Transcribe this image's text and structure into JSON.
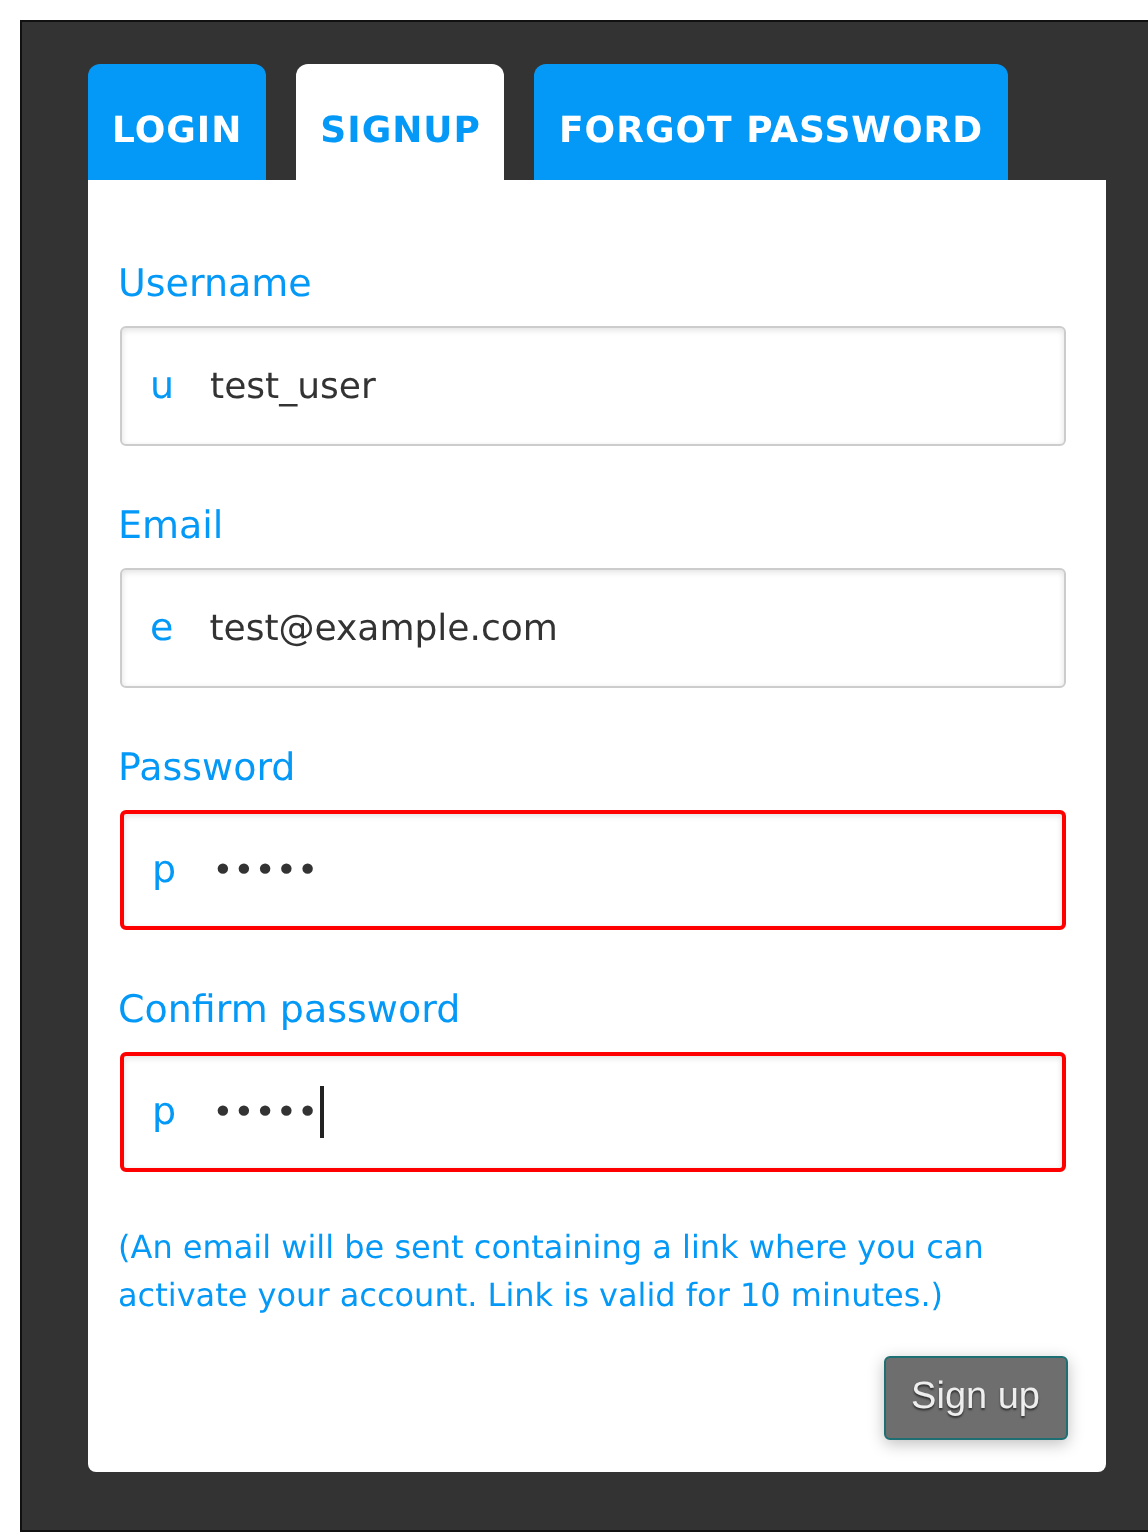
{
  "tabs": [
    {
      "label": "LOGIN",
      "selected": false
    },
    {
      "label": "SIGNUP",
      "selected": true
    },
    {
      "label": "FORGOT PASSWORD",
      "selected": false
    }
  ],
  "fields": [
    {
      "label": "Username",
      "prefix": "u",
      "value": "test_user",
      "invalid": false,
      "focused": false
    },
    {
      "label": "Email",
      "prefix": "e",
      "value": "test@example.com",
      "invalid": false,
      "focused": false
    },
    {
      "label": "Password",
      "prefix": "p",
      "value": "•••••",
      "invalid": true,
      "focused": false
    },
    {
      "label": "Confirm password",
      "prefix": "p",
      "value": "•••••",
      "invalid": true,
      "focused": true
    }
  ],
  "note": "(An email will be sent containing a link where you can activate your account. Link is valid for 10 minutes.)",
  "submit_button": "Sign up"
}
